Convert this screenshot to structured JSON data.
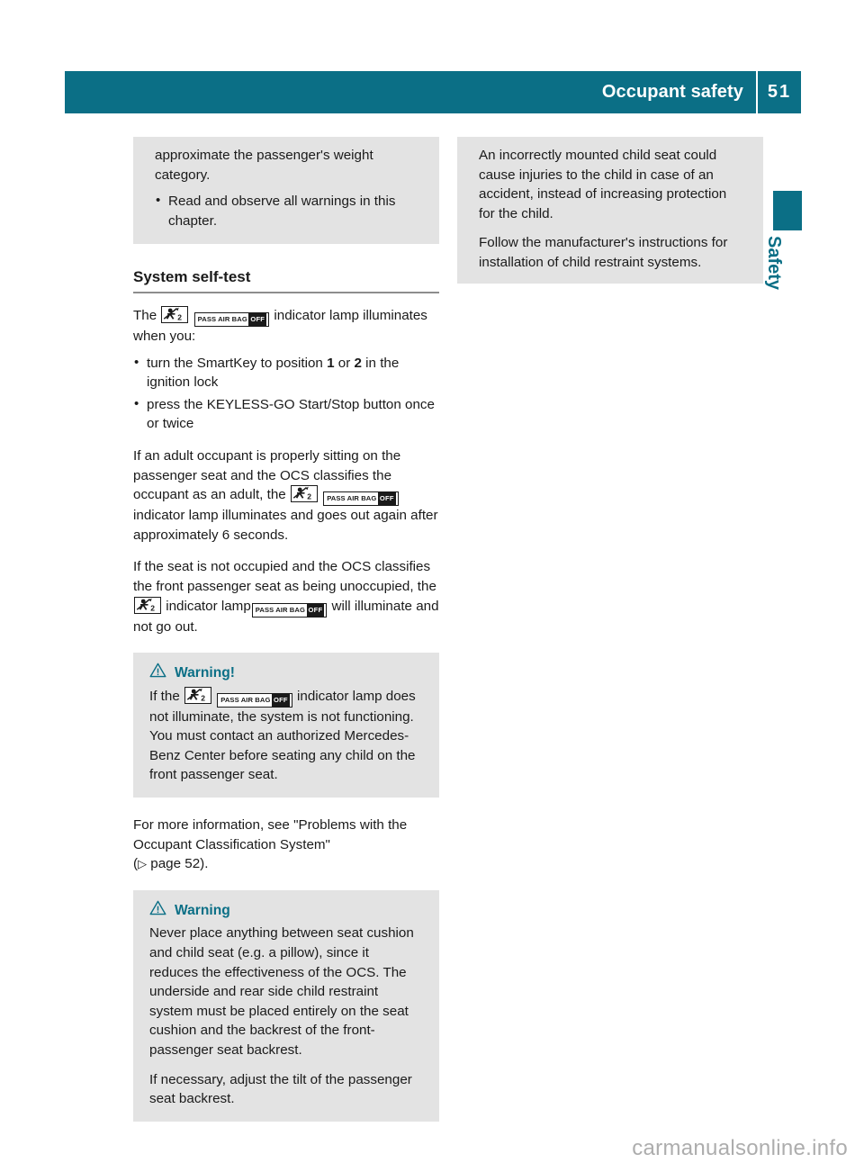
{
  "header": {
    "title": "Occupant safety",
    "page_number": "51"
  },
  "side_tab": {
    "label": "Safety",
    "accent_color": "#0b6f86"
  },
  "watermark": "carmanualsonline.info",
  "icons": {
    "lamp": "child-seat-indicator-icon",
    "pass_air_bag_text": "PASS AIR BAG",
    "pass_air_bag_off": "OFF",
    "warning_triangle": "warning-triangle-icon",
    "page_ref_arrow": "▷",
    "bullet": "•"
  },
  "left_column": {
    "continued_box": {
      "paragraph": "approximate the passenger's weight category.",
      "bullets": [
        "Read and observe all warnings in this chapter."
      ]
    },
    "section": {
      "heading": "System self-test",
      "intro_before_icons": "The",
      "intro_after_icons": "indicator lamp illuminates when you:",
      "bullets": [
        {
          "pre": "turn the SmartKey to position ",
          "bold1": "1",
          "mid": " or ",
          "bold2": "2",
          "post": " in the ignition lock"
        },
        {
          "pre": "press the KEYLESS-GO Start/Stop button once or twice",
          "bold1": "",
          "mid": "",
          "bold2": "",
          "post": ""
        }
      ],
      "para_adult_before": "If an adult occupant is properly sitting on the passenger seat and the OCS classifies the occupant as an adult, the",
      "para_adult_after": "indicator lamp illuminates and goes out again after approximately 6 seconds.",
      "para_unoccupied_before": "If the seat is not occupied and the OCS classifies the front passenger seat as being unoccupied, the",
      "para_unoccupied_mid": "indicator lamp",
      "para_unoccupied_after": "will illuminate and not go out."
    },
    "warning_1": {
      "title": "Warning!",
      "before_icons": "If the",
      "after_icons": "indicator lamp does not illuminate, the system is not functioning. You must contact an authorized Mercedes-Benz Center before seating any child on the front passenger seat."
    },
    "more_info": {
      "line1": "For more information, see \"Problems with the Occupant Classification System\"",
      "ref_open": "(",
      "ref_text": " page 52)."
    },
    "warning_2": {
      "title": "Warning",
      "paragraphs": [
        "Never place anything between seat cushion and child seat (e.g. a pillow), since it reduces the effectiveness of the OCS. The underside and rear side child restraint system must be placed entirely on the seat cushion and the backrest of the front-passenger seat backrest.",
        "If necessary, adjust the tilt of the passenger seat backrest."
      ]
    }
  },
  "right_column": {
    "continued_box": {
      "paragraphs": [
        "An incorrectly mounted child seat could cause injuries to the child in case of an accident, instead of increasing protection for the child.",
        "Follow the manufacturer's instructions for installation of child restraint systems."
      ]
    }
  }
}
